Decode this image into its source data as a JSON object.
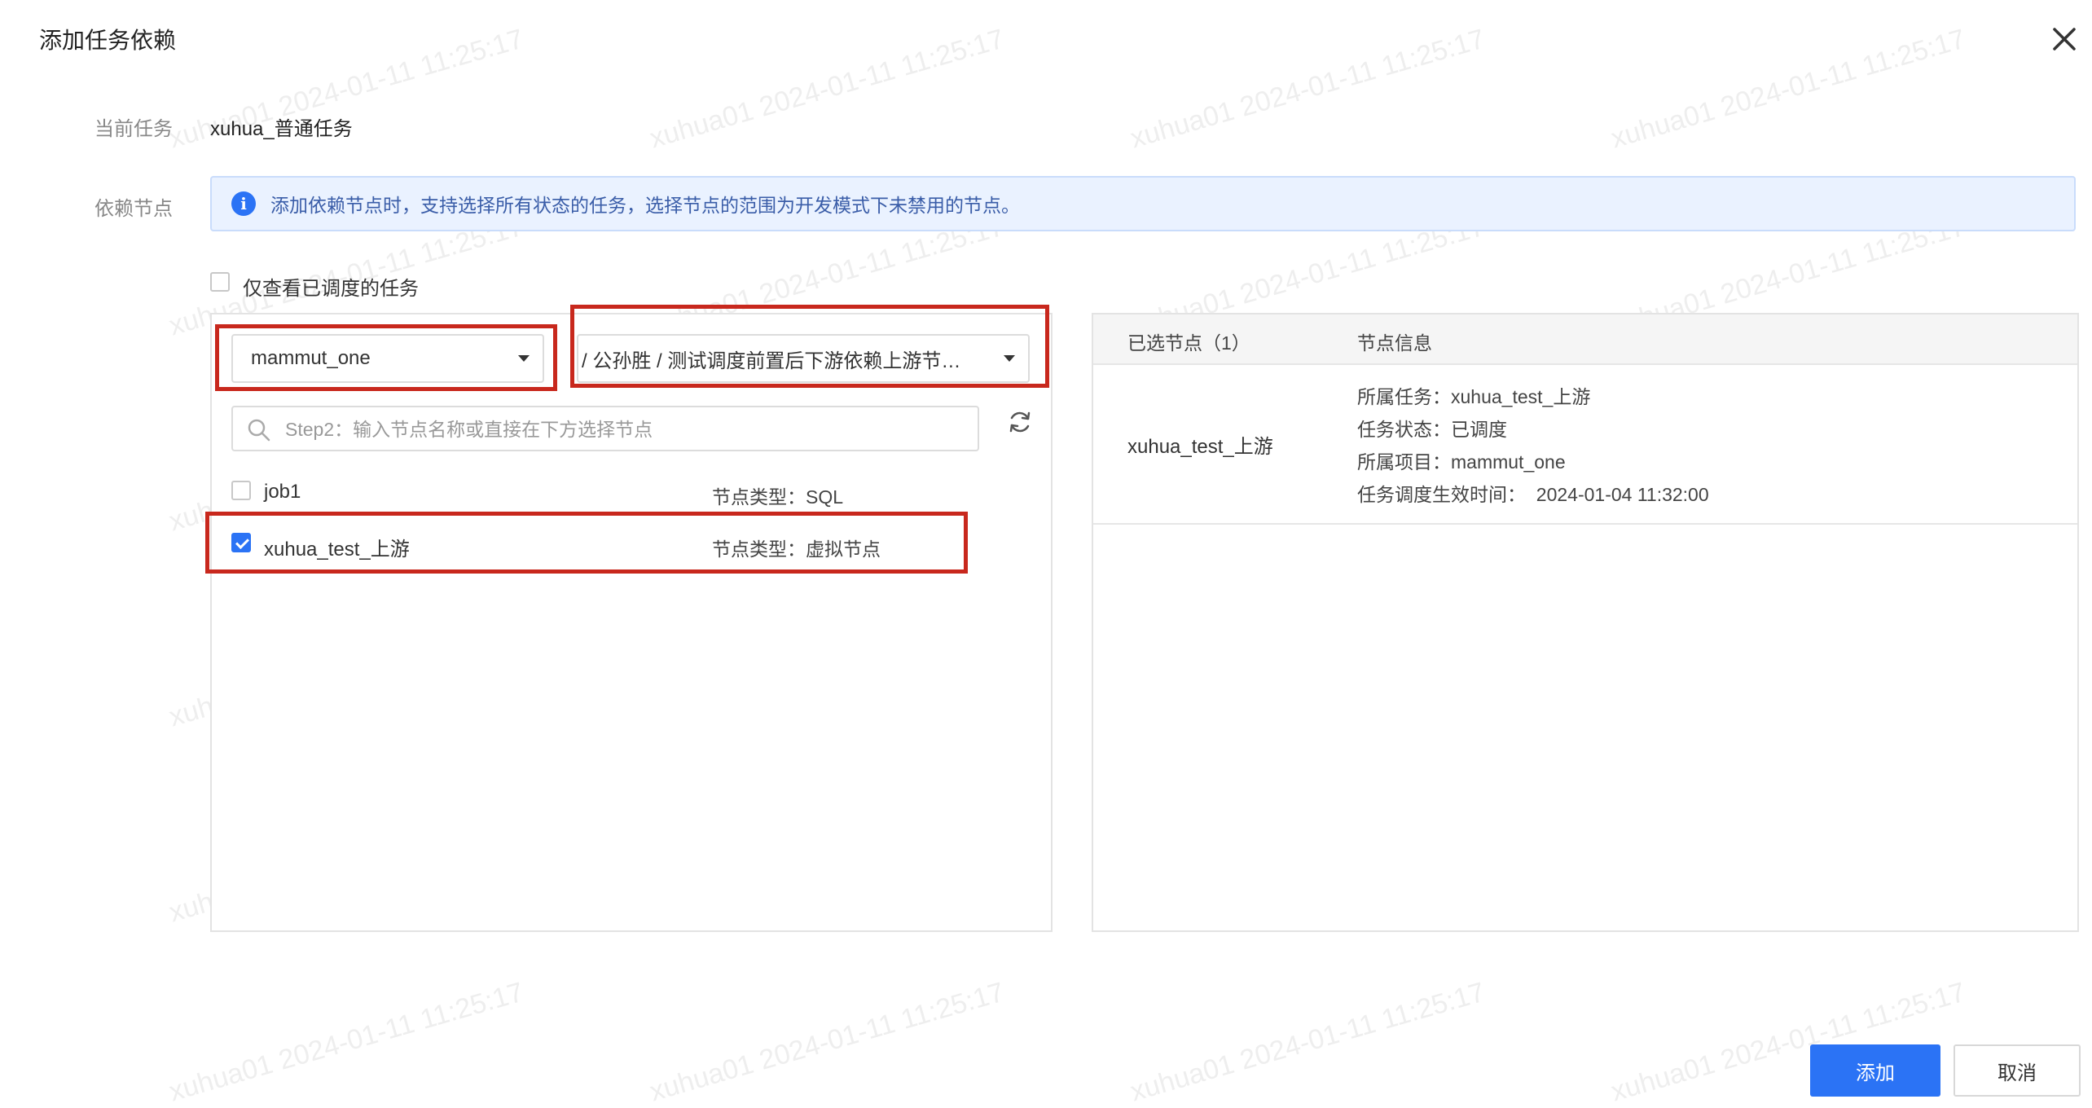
{
  "dialog": {
    "title": "添加任务依赖"
  },
  "current_task": {
    "label": "当前任务",
    "value": "xuhua_普通任务"
  },
  "dependency": {
    "label": "依赖节点",
    "notice": "添加依赖节点时，支持选择所有状态的任务，选择节点的范围为开发模式下未禁用的节点。",
    "only_scheduled_label": "仅查看已调度的任务",
    "project_select": "mammut_one",
    "path_select": "/ 公孙胜 / 测试调度前置后下游依赖上游节…",
    "search_placeholder": "Step2：输入节点名称或直接在下方选择节点",
    "nodes": [
      {
        "name": "job1",
        "type": "节点类型：SQL",
        "checked": false
      },
      {
        "name": "xuhua_test_上游",
        "type": "节点类型：虚拟节点",
        "checked": true
      }
    ]
  },
  "selected": {
    "col_selected": "已选节点（1）",
    "col_info": "节点信息",
    "node_name": "xuhua_test_上游",
    "info": {
      "task": "所属任务：xuhua_test_上游",
      "status": "任务状态：已调度",
      "project": "所属项目：mammut_one",
      "effective_time": "任务调度生效时间：  2024-01-04 11:32:00"
    }
  },
  "buttons": {
    "add": "添加",
    "cancel": "取消"
  },
  "watermark": "xuhua01 2024-01-11 11:25:17",
  "colors": {
    "primary": "#2b73f5",
    "highlight_red": "#c8281d",
    "notice_bg": "#eaf2ff"
  }
}
